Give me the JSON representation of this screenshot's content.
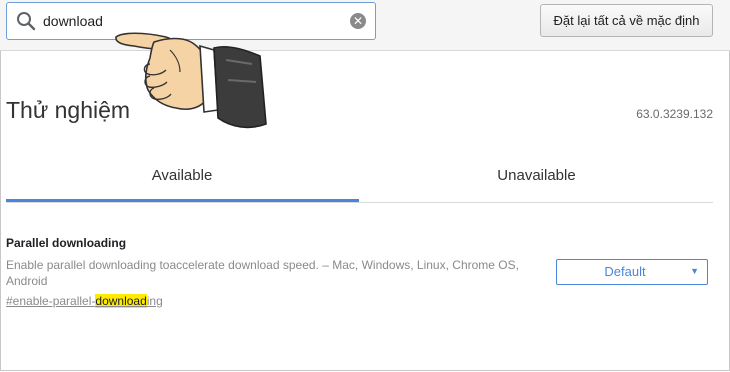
{
  "search": {
    "value": "download",
    "icon": "search-icon"
  },
  "toolbar": {
    "reset_label": "Đặt lại tất cả về mặc định"
  },
  "page": {
    "title": "Thử nghiệm",
    "version": "63.0.3239.132"
  },
  "tabs": [
    {
      "label": "Available",
      "selected": true
    },
    {
      "label": "Unavailable",
      "selected": false
    }
  ],
  "experiment": {
    "title": "Parallel downloading",
    "description": "Enable parallel downloading toaccelerate download speed.  – Mac, Windows, Linux, Chrome OS, Android",
    "link_prefix": "#enable-parallel-",
    "link_highlight": "download",
    "link_suffix": "ing",
    "select_value": "Default"
  },
  "colors": {
    "accent": "#4a86d8",
    "highlight": "#ffeb00"
  }
}
